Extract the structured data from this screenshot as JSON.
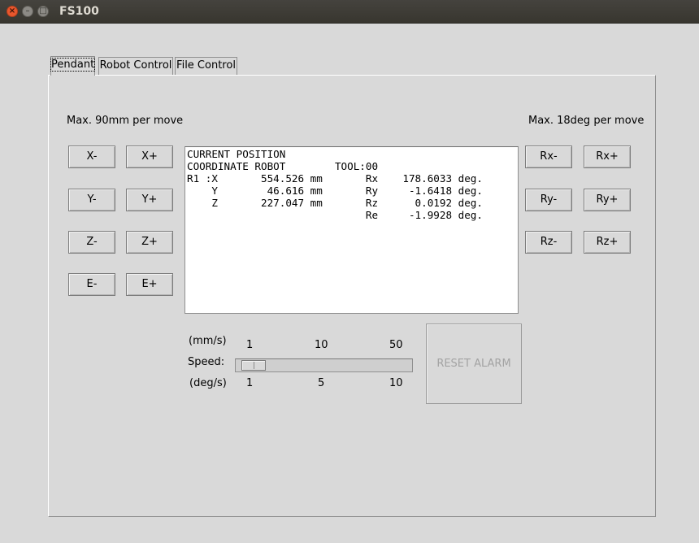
{
  "window": {
    "title": "FS100",
    "close_glyph": "×",
    "minimize_glyph": "–",
    "maximize_glyph": "□"
  },
  "tabs": [
    {
      "label": "Pendant",
      "active": true
    },
    {
      "label": "Robot Control",
      "active": false
    },
    {
      "label": "File Control",
      "active": false
    }
  ],
  "pendant": {
    "linear_limit_label": "Max. 90mm per move",
    "angular_limit_label": "Max. 18deg per move",
    "linear_buttons": {
      "x_minus": "X-",
      "x_plus": "X+",
      "y_minus": "Y-",
      "y_plus": "Y+",
      "z_minus": "Z-",
      "z_plus": "Z+",
      "e_minus": "E-",
      "e_plus": "E+"
    },
    "rotation_buttons": {
      "rx_minus": "Rx-",
      "rx_plus": "Rx+",
      "ry_minus": "Ry-",
      "ry_plus": "Ry+",
      "rz_minus": "Rz-",
      "rz_plus": "Rz+"
    },
    "position_text": "CURRENT POSITION\nCOORDINATE ROBOT        TOOL:00\nR1 :X       554.526 mm       Rx    178.6033 deg.\n    Y        46.616 mm       Ry     -1.6418 deg.\n    Z       227.047 mm       Rz      0.0192 deg.\n                             Re     -1.9928 deg.",
    "speed": {
      "linear_unit": "(mm/s)",
      "linear_ticks": [
        "1",
        "10",
        "50"
      ],
      "label": "Speed:",
      "angular_unit": "(deg/s)",
      "angular_ticks": [
        "1",
        "5",
        "10"
      ],
      "slider_fraction": 0.03
    },
    "reset_alarm_label": "RESET ALARM",
    "reset_alarm_enabled": false
  }
}
